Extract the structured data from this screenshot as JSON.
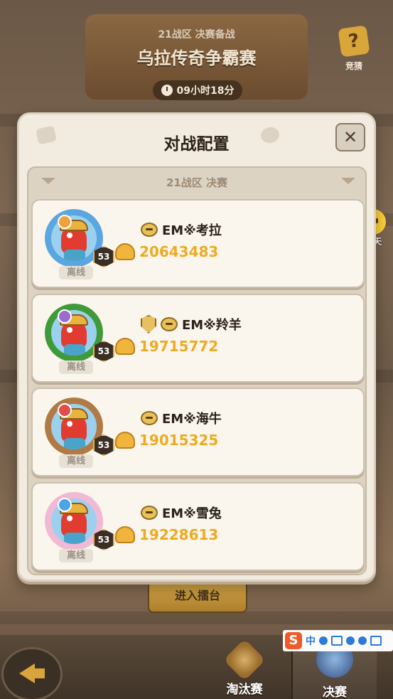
{
  "background": {
    "subtitle": "21战区 决赛备战",
    "title": "乌拉传奇争霸赛",
    "timer": "09小时18分",
    "guess_label": "竞猜",
    "enter_button": "进入擂台",
    "chat_label": "聊天",
    "tabs": [
      {
        "label": "淘汰赛",
        "icon": "crossed-swords-icon"
      },
      {
        "label": "决赛",
        "icon": "crown-trophy-icon"
      }
    ],
    "ime_label": "中"
  },
  "modal": {
    "title": "对战配置",
    "close_label": "✕",
    "section_title": "21战区 决赛",
    "players": [
      {
        "name": "EM※考拉",
        "power": "20643483",
        "level": "53",
        "status": "离线",
        "ring_color": "#5aa6e0",
        "badge_color": "#f0a03a"
      },
      {
        "name": "EM※羚羊",
        "power": "19715772",
        "level": "53",
        "status": "离线",
        "ring_color": "#3f9a3a",
        "badge_color": "#9b6cd0",
        "has_shield": true
      },
      {
        "name": "EM※海牛",
        "power": "19015325",
        "level": "53",
        "status": "离线",
        "ring_color": "#b07a46",
        "badge_color": "#e04d4d"
      },
      {
        "name": "EM※雪兔",
        "power": "19228613",
        "level": "53",
        "status": "离线",
        "ring_color": "#f1b9d6",
        "badge_color": "#4aa6e6"
      }
    ]
  }
}
